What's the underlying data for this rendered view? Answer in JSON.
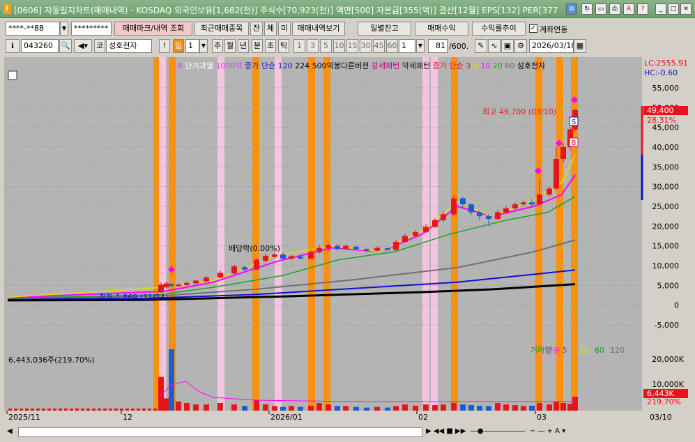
{
  "title": "[0606] 자동일지차트(매매내역) - KOSDAQ 외국인보유[1,682(천)] 주식수[70,923(천)] 액면[500] 자본금[355(억)] 결산[12월] EPS[132] PER[377",
  "toolbar1": {
    "account": "****-**88",
    "password": "*********",
    "trade_mark": "매매마크/내역 조회",
    "recent_items": "최근매매종목",
    "btn_jan": "잔",
    "btn_che": "체",
    "btn_mi": "미",
    "trade_history": "매매내역보기",
    "daily_balance": "일별잔고",
    "trade_profit": "매매수익",
    "yield_trend": "수익률추이",
    "account_link": "계좌연동"
  },
  "toolbar2": {
    "code": "043260",
    "market": "코",
    "stock_name": "성호전자",
    "period_day": "일",
    "period_num": "1",
    "period_week": "주",
    "period_month": "월",
    "period_year": "년",
    "period_min": "분",
    "period_sec": "초",
    "period_tick": "틱",
    "intervals": [
      "1",
      "3",
      "5",
      "10",
      "15",
      "30",
      "45",
      "60"
    ],
    "interval_num": "1",
    "count": "81",
    "count_total": "/600.",
    "date": "2026/03/10"
  },
  "legend": {
    "a": "8",
    "b": "단기과열",
    "c": "1000억",
    "d": "종가 단순 120",
    "e": "224",
    "f": "500억봉다른버전",
    "g": "강세패턴",
    "h": "약세패턴",
    "i": "종가 단순 3",
    "j": "5",
    "k": "10",
    "l": "20",
    "m": "60",
    "n": "성호전자"
  },
  "right_info": {
    "lc": "LC:2555.91",
    "hc": "HC:-0.60"
  },
  "annotations": {
    "high": "최고 49,700 (03/10)",
    "low": "최저 1,869 (11/24)",
    "dividend": "배당락(0.00%)",
    "volume_info": "6,443,036주(219.70%)",
    "price_tag": "49,400",
    "pct_tag": "28.31%",
    "vol_tag": "6,443K",
    "vol_pct_tag": "219.70%"
  },
  "price_axis": [
    "55,000",
    "50,000",
    "45,000",
    "40,000",
    "35,000",
    "30,000",
    "25,000",
    "20,000",
    "15,000",
    "10,000",
    "5,000",
    "0",
    "-5,000"
  ],
  "volume_axis": [
    "20,000K",
    "10,000K"
  ],
  "volume_legend": {
    "v1": "거래량",
    "v2": "단순 5",
    "v3": "20",
    "v4": "60",
    "v5": "120"
  },
  "date_axis": [
    "2025/11",
    "12",
    "2026/01",
    "02",
    "03"
  ],
  "date_end": "03/10",
  "colors": {
    "up": "#e8141c",
    "down": "#1c5ad6",
    "highlight": "#ff8c00",
    "pink": "#ffc8e6",
    "bg": "#b4b4b4"
  }
}
